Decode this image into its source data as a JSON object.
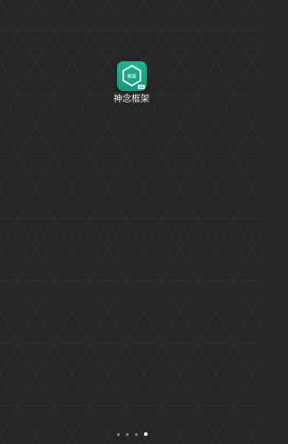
{
  "home_screen": {
    "apps": [
      {
        "label": "神念框架",
        "icon": "hexagon-framework-icon",
        "icon_text": "框架",
        "badge_text": "EX",
        "color": "#19a685"
      }
    ],
    "page_indicator": {
      "total_pages": 4,
      "current_page": 4
    }
  },
  "colors": {
    "background": "#262626",
    "pattern_line": "#323232"
  }
}
